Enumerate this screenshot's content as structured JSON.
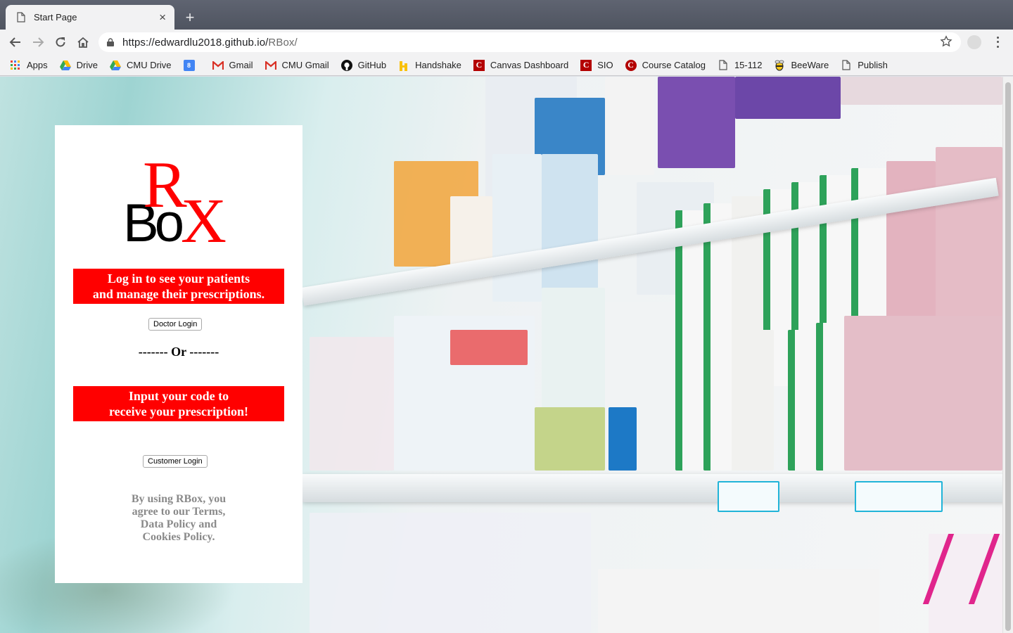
{
  "browser": {
    "tab": {
      "title": "Start Page",
      "close": "×"
    },
    "new_tab": "+",
    "url": {
      "host": "https://edwardlu2018.github.io/",
      "path": "RBox/"
    },
    "bookmarks": [
      {
        "label": "Apps",
        "icon": "apps-grid-icon"
      },
      {
        "label": "Drive",
        "icon": "google-drive-icon"
      },
      {
        "label": "CMU Drive",
        "icon": "google-drive-icon"
      },
      {
        "label": "",
        "icon": "calendar-icon",
        "text": "8"
      },
      {
        "label": "Gmail",
        "icon": "gmail-icon"
      },
      {
        "label": "CMU Gmail",
        "icon": "gmail-icon"
      },
      {
        "label": "GitHub",
        "icon": "github-icon"
      },
      {
        "label": "Handshake",
        "icon": "handshake-icon"
      },
      {
        "label": "Canvas Dashboard",
        "icon": "canvas-icon"
      },
      {
        "label": "SIO",
        "icon": "canvas-icon"
      },
      {
        "label": "Course Catalog",
        "icon": "canvas-icon"
      },
      {
        "label": "15-112",
        "icon": "page-icon"
      },
      {
        "label": "BeeWare",
        "icon": "beeware-icon"
      },
      {
        "label": "Publish",
        "icon": "page-icon"
      }
    ]
  },
  "page": {
    "logo": {
      "r": "R",
      "x": "X",
      "bo": "Bo"
    },
    "doctor_prompt": [
      "Log in to see your patients",
      "and manage their prescriptions."
    ],
    "doctor_button": "Doctor Login",
    "or_divider": "------- Or -------",
    "customer_prompt": [
      "Input your code to",
      "receive your prescription!"
    ],
    "customer_button": "Customer Login",
    "terms": [
      "By using RBox, you",
      "agree to our Terms,",
      "Data Policy and",
      "Cookies Policy."
    ]
  },
  "colors": {
    "brand_red": "#ff0000",
    "terms_gray": "#8a8a8a"
  }
}
